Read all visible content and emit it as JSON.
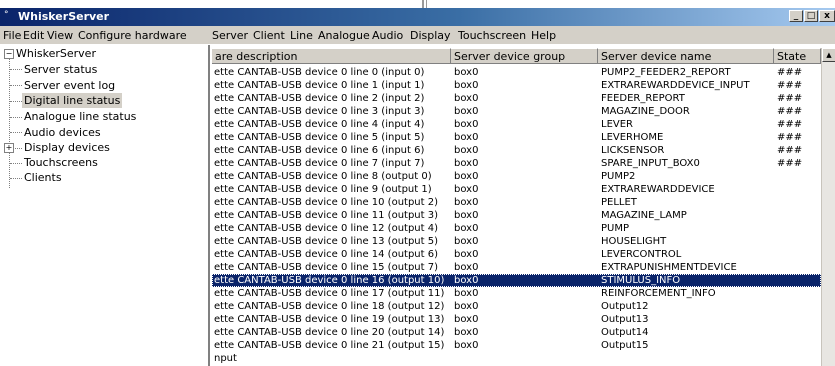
{
  "window": {
    "title": "WhiskerServer",
    "minimize": "_",
    "maximize": "□",
    "close": "x"
  },
  "menu": [
    "File",
    "Edit",
    "View",
    "Configure hardware",
    "Server",
    "Client",
    "Line",
    "Analogue",
    "Audio",
    "Display",
    "Touchscreen",
    "Help"
  ],
  "tree": {
    "root": "WhiskerServer",
    "items": [
      "Server status",
      "Server event log",
      "Digital line status",
      "Analogue line status",
      "Audio devices",
      "Display devices",
      "Touchscreens",
      "Clients"
    ],
    "selected": "Digital line status"
  },
  "list": {
    "columns": [
      "are description",
      "Server device group",
      "Server device name",
      "State"
    ],
    "rows": [
      [
        "ette CANTAB-USB device 0 line 0 (input 0)",
        "box0",
        "PUMP2_FEEDER2_REPORT",
        "###"
      ],
      [
        "ette CANTAB-USB device 0 line 1 (input 1)",
        "box0",
        "EXTRAREWARDDEVICE_INPUT",
        "###"
      ],
      [
        "ette CANTAB-USB device 0 line 2 (input 2)",
        "box0",
        "FEEDER_REPORT",
        "###"
      ],
      [
        "ette CANTAB-USB device 0 line 3 (input 3)",
        "box0",
        "MAGAZINE_DOOR",
        "###"
      ],
      [
        "ette CANTAB-USB device 0 line 4 (input 4)",
        "box0",
        "LEVER",
        "###"
      ],
      [
        "ette CANTAB-USB device 0 line 5 (input 5)",
        "box0",
        "LEVERHOME",
        "###"
      ],
      [
        "ette CANTAB-USB device 0 line 6 (input 6)",
        "box0",
        "LICKSENSOR",
        "###"
      ],
      [
        "ette CANTAB-USB device 0 line 7 (input 7)",
        "box0",
        "SPARE_INPUT_BOX0",
        "###"
      ],
      [
        "ette CANTAB-USB device 0 line 8 (output 0)",
        "box0",
        "PUMP2",
        ""
      ],
      [
        "ette CANTAB-USB device 0 line 9 (output 1)",
        "box0",
        "EXTRAREWARDDEVICE",
        ""
      ],
      [
        "ette CANTAB-USB device 0 line 10 (output 2)",
        "box0",
        "PELLET",
        ""
      ],
      [
        "ette CANTAB-USB device 0 line 11 (output 3)",
        "box0",
        "MAGAZINE_LAMP",
        ""
      ],
      [
        "ette CANTAB-USB device 0 line 12 (output 4)",
        "box0",
        "PUMP",
        ""
      ],
      [
        "ette CANTAB-USB device 0 line 13 (output 5)",
        "box0",
        "HOUSELIGHT",
        ""
      ],
      [
        "ette CANTAB-USB device 0 line 14 (output 6)",
        "box0",
        "LEVERCONTROL",
        ""
      ],
      [
        "ette CANTAB-USB device 0 line 15 (output 7)",
        "box0",
        "EXTRAPUNISHMENTDEVICE",
        ""
      ],
      [
        "ette CANTAB-USB device 0 line 16 (output 10)",
        "box0",
        "STIMULUS_INFO",
        ""
      ],
      [
        "ette CANTAB-USB device 0 line 17 (output 11)",
        "box0",
        "REINFORCEMENT_INFO",
        ""
      ],
      [
        "ette CANTAB-USB device 0 line 18 (output 12)",
        "box0",
        "Output12",
        ""
      ],
      [
        "ette CANTAB-USB device 0 line 19 (output 13)",
        "box0",
        "Output13",
        ""
      ],
      [
        "ette CANTAB-USB device 0 line 20 (output 14)",
        "box0",
        "Output14",
        ""
      ],
      [
        "ette CANTAB-USB device 0 line 21 (output 15)",
        "box0",
        "Output15",
        ""
      ],
      [
        "nput",
        "",
        "",
        ""
      ]
    ],
    "selected_row": "ette CANTAB-USB device 0 line 16 (output 10)"
  },
  "icons": {
    "app": "app-icon",
    "expand_root": "minus-box-icon",
    "expand_display": "plus-box-icon",
    "scroll_up": "triangle-up-icon"
  }
}
